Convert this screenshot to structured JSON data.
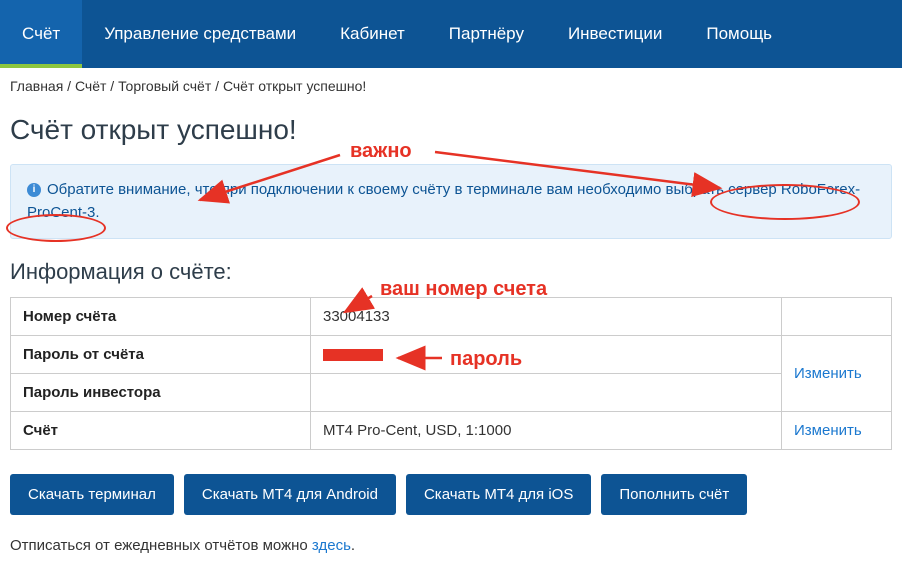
{
  "nav": {
    "items": [
      {
        "label": "Счёт",
        "active": true
      },
      {
        "label": "Управление средствами",
        "active": false
      },
      {
        "label": "Кабинет",
        "active": false
      },
      {
        "label": "Партнёру",
        "active": false
      },
      {
        "label": "Инвестиции",
        "active": false
      },
      {
        "label": "Помощь",
        "active": false
      }
    ]
  },
  "breadcrumb": {
    "home": "Главная",
    "sep": " / ",
    "acct": "Счёт",
    "trade": "Торговый счёт",
    "current": "Счёт открыт успешно!"
  },
  "page_title": "Счёт открыт успешно!",
  "alert": {
    "text": "Обратите внимание, что при подключении к своему счёту в терминале вам необходимо выбрать сервер RoboForex-ProCent-3."
  },
  "section_title": "Информация о счёте:",
  "table": {
    "rows": [
      {
        "label": "Номер счёта",
        "value": "33004133",
        "action": ""
      },
      {
        "label": "Пароль от счёта",
        "value": "",
        "action": "Изменить",
        "redacted": true
      },
      {
        "label": "Пароль инвестора",
        "value": "",
        "action": ""
      },
      {
        "label": "Счёт",
        "value": "MT4 Pro-Cent, USD, 1:1000",
        "action": "Изменить"
      }
    ]
  },
  "buttons": {
    "download_terminal": "Скачать терминал",
    "mt4_android": "Скачать MT4 для Android",
    "mt4_ios": "Скачать MT4 для iOS",
    "deposit": "Пополнить счёт"
  },
  "unsubscribe": {
    "text": "Отписаться от ежедневных отчётов можно ",
    "link": "здесь",
    "after": "."
  },
  "annotations": {
    "important": "важно",
    "account_number": "ваш номер счета",
    "password": "пароль"
  }
}
